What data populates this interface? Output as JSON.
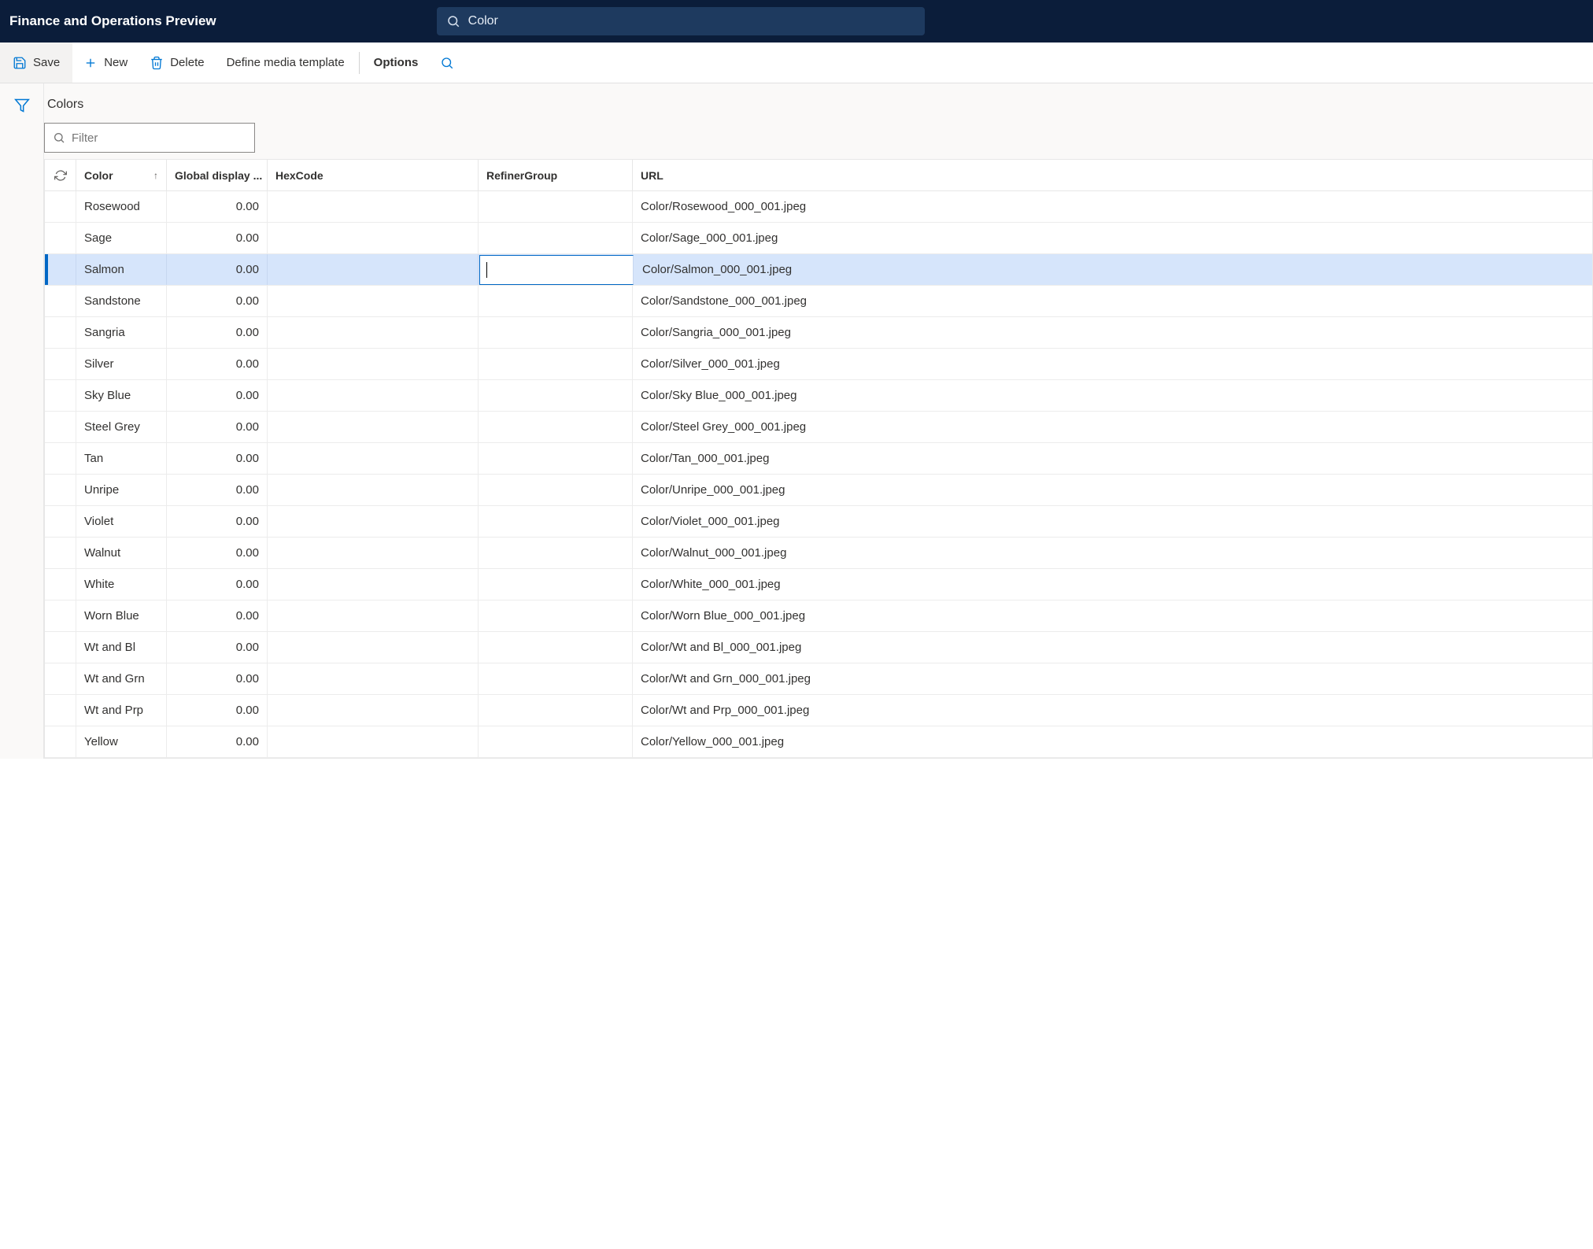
{
  "header": {
    "app_title": "Finance and Operations Preview",
    "search_text": "Color"
  },
  "actions": {
    "save": "Save",
    "new": "New",
    "delete": "Delete",
    "define_media": "Define media template",
    "options": "Options"
  },
  "page": {
    "title": "Colors",
    "filter_placeholder": "Filter"
  },
  "columns": {
    "color": "Color",
    "global_display": "Global display ...",
    "hexcode": "HexCode",
    "refiner": "RefinerGroup",
    "url": "URL"
  },
  "selected_index": 2,
  "editing_col": "refiner",
  "rows": [
    {
      "color": "Rosewood",
      "global": "0.00",
      "hex": "",
      "refiner": "",
      "url": "Color/Rosewood_000_001.jpeg"
    },
    {
      "color": "Sage",
      "global": "0.00",
      "hex": "",
      "refiner": "",
      "url": "Color/Sage_000_001.jpeg"
    },
    {
      "color": "Salmon",
      "global": "0.00",
      "hex": "",
      "refiner": "",
      "url": "Color/Salmon_000_001.jpeg"
    },
    {
      "color": "Sandstone",
      "global": "0.00",
      "hex": "",
      "refiner": "",
      "url": "Color/Sandstone_000_001.jpeg"
    },
    {
      "color": "Sangria",
      "global": "0.00",
      "hex": "",
      "refiner": "",
      "url": "Color/Sangria_000_001.jpeg"
    },
    {
      "color": "Silver",
      "global": "0.00",
      "hex": "",
      "refiner": "",
      "url": "Color/Silver_000_001.jpeg"
    },
    {
      "color": "Sky Blue",
      "global": "0.00",
      "hex": "",
      "refiner": "",
      "url": "Color/Sky Blue_000_001.jpeg"
    },
    {
      "color": "Steel Grey",
      "global": "0.00",
      "hex": "",
      "refiner": "",
      "url": "Color/Steel Grey_000_001.jpeg"
    },
    {
      "color": "Tan",
      "global": "0.00",
      "hex": "",
      "refiner": "",
      "url": "Color/Tan_000_001.jpeg"
    },
    {
      "color": "Unripe",
      "global": "0.00",
      "hex": "",
      "refiner": "",
      "url": "Color/Unripe_000_001.jpeg"
    },
    {
      "color": "Violet",
      "global": "0.00",
      "hex": "",
      "refiner": "",
      "url": "Color/Violet_000_001.jpeg"
    },
    {
      "color": "Walnut",
      "global": "0.00",
      "hex": "",
      "refiner": "",
      "url": "Color/Walnut_000_001.jpeg"
    },
    {
      "color": "White",
      "global": "0.00",
      "hex": "",
      "refiner": "",
      "url": "Color/White_000_001.jpeg"
    },
    {
      "color": "Worn Blue",
      "global": "0.00",
      "hex": "",
      "refiner": "",
      "url": "Color/Worn Blue_000_001.jpeg"
    },
    {
      "color": "Wt and Bl",
      "global": "0.00",
      "hex": "",
      "refiner": "",
      "url": "Color/Wt and Bl_000_001.jpeg"
    },
    {
      "color": "Wt and Grn",
      "global": "0.00",
      "hex": "",
      "refiner": "",
      "url": "Color/Wt and Grn_000_001.jpeg"
    },
    {
      "color": "Wt and Prp",
      "global": "0.00",
      "hex": "",
      "refiner": "",
      "url": "Color/Wt and Prp_000_001.jpeg"
    },
    {
      "color": "Yellow",
      "global": "0.00",
      "hex": "",
      "refiner": "",
      "url": "Color/Yellow_000_001.jpeg"
    }
  ]
}
